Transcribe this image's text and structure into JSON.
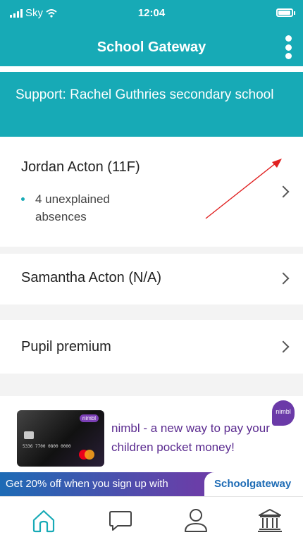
{
  "status_bar": {
    "carrier": "Sky",
    "time": "12:04"
  },
  "nav": {
    "title": "School Gateway"
  },
  "support_banner": {
    "text": "Support: Rachel Guthries secondary school"
  },
  "pupils": [
    {
      "name": "Jordan Acton (11F)",
      "alerts": [
        "4 unexplained absences"
      ]
    },
    {
      "name": "Samantha Acton (N/A)",
      "alerts": []
    }
  ],
  "pupil_premium": {
    "label": "Pupil premium"
  },
  "ad": {
    "headline": "nimbl - a new way to pay your children pocket money!",
    "brand": "nimbl",
    "card_number": "5336 7700 0800 0000",
    "promo": "Get 20% off when you sign up with",
    "promo_brand": "Schoolgateway"
  },
  "tabs": [
    {
      "name": "home",
      "icon": "home-icon",
      "active": true
    },
    {
      "name": "messages",
      "icon": "chat-bubble-icon",
      "active": false
    },
    {
      "name": "profile",
      "icon": "person-icon",
      "active": false
    },
    {
      "name": "school",
      "icon": "bank-icon",
      "active": false
    }
  ],
  "colors": {
    "accent": "#17aab6",
    "ad_purple": "#5a2a8f",
    "annotation": "#e02020"
  }
}
